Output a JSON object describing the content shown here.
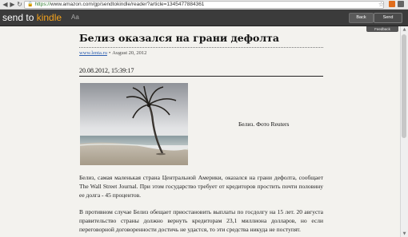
{
  "browser": {
    "url_scheme": "https://",
    "url_rest": "www.amazon.com/gp/sendtokindle/reader?article=1345477884361"
  },
  "toolbar": {
    "logo_prefix": "send to ",
    "logo_brand": "kindle",
    "font_size_label": "Aa",
    "back_label": "Back",
    "send_label": "Send",
    "feedback_label": "Feedback"
  },
  "article": {
    "title": "Белиз оказался на грани дефолта",
    "source_link": "www.lenta.ru",
    "source_separator": "•",
    "date": "August 20, 2012",
    "timestamp": "20.08.2012, 15:39:17",
    "image_caption": "Белиз. Фото Reuters",
    "paragraphs": [
      "Белиз, самая маленькая страна Центральной Америки, оказался на грани дефолта, сообщает The Wall Street Journal. При этом государство требует от кредиторов простить почти половину ее долга - 45 процентов.",
      "В противном случае Белиз обещает приостановить выплаты по госдолгу на 15 лет. 20 августа правительство страны должно вернуть кредиторам 23,1 миллиона долларов, но если переговорной договоренности достичь не удастся, то эти средства никуда не поступят."
    ]
  },
  "colors": {
    "toolbar_bg": "#3b3b3b",
    "brand_orange": "#f4a21c",
    "page_bg": "#f3f2ee",
    "link_blue": "#2a5db0"
  }
}
